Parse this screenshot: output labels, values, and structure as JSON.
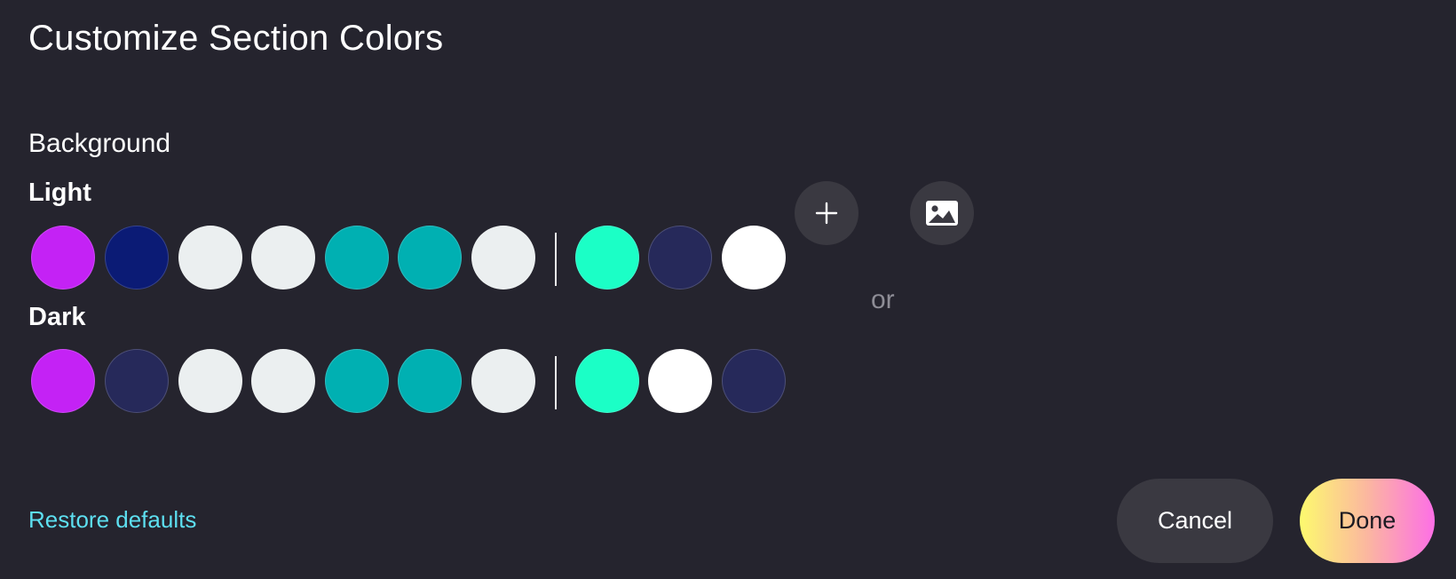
{
  "dialog": {
    "title": "Customize Section Colors"
  },
  "background": {
    "label": "Background",
    "light": {
      "label": "Light",
      "swatches": [
        "#c422f5",
        "#0b1b75",
        "#ebeff0",
        "#ebeff0",
        "#00b0b2",
        "#00b0b2",
        "#ebeff0",
        "#1bffc6",
        "#26295a",
        "#ffffff"
      ]
    },
    "dark": {
      "label": "Dark",
      "swatches": [
        "#c422f5",
        "#26295a",
        "#ebeff0",
        "#ebeff0",
        "#00b0b2",
        "#00b0b2",
        "#ebeff0",
        "#1bffc6",
        "#ffffff",
        "#26295a"
      ]
    },
    "or_label": "or",
    "add_icon": "plus-icon",
    "image_icon": "image-icon"
  },
  "footer": {
    "restore_label": "Restore defaults",
    "cancel_label": "Cancel",
    "done_label": "Done"
  },
  "colors": {
    "background": "#25242e",
    "link": "#5ddff0",
    "button_bg": "#3a3941"
  }
}
